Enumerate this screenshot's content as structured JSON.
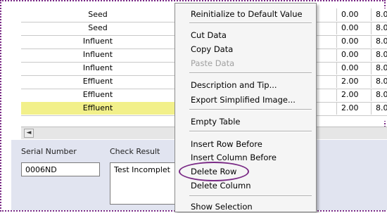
{
  "table": {
    "rows": [
      {
        "name": "Seed",
        "v1": "0.00",
        "v2": "8.0",
        "selected": false
      },
      {
        "name": "Seed",
        "v1": "0.00",
        "v2": "8.0",
        "selected": false
      },
      {
        "name": "Influent",
        "v1": "0.00",
        "v2": "8.0",
        "selected": false
      },
      {
        "name": "Influent",
        "v1": "0.00",
        "v2": "8.0",
        "selected": false
      },
      {
        "name": "Influent",
        "v1": "0.00",
        "v2": "8.0",
        "selected": false
      },
      {
        "name": "Effluent",
        "v1": "2.00",
        "v2": "8.0",
        "selected": false
      },
      {
        "name": "Effluent",
        "v1": "2.00",
        "v2": "8.0",
        "selected": false
      },
      {
        "name": "Effluent",
        "v1": "2.00",
        "v2": "8.0",
        "selected": true
      }
    ]
  },
  "scrollbar": {
    "left_arrow": "◄"
  },
  "panel": {
    "serial_label": "Serial Number",
    "serial_value": "0006ND",
    "check_label": "Check Result",
    "check_value": "Test Incomplet"
  },
  "menu": {
    "items": [
      {
        "label": "Reinitialize to Default Value",
        "disabled": false
      },
      {
        "label": "Cut Data",
        "disabled": false
      },
      {
        "label": "Copy Data",
        "disabled": false
      },
      {
        "label": "Paste Data",
        "disabled": true
      },
      {
        "label": "Description and Tip...",
        "disabled": false
      },
      {
        "label": "Export Simplified Image...",
        "disabled": false
      },
      {
        "label": "Empty Table",
        "disabled": false
      },
      {
        "label": "Insert Row Before",
        "disabled": false
      },
      {
        "label": "Insert Column Before",
        "disabled": false
      },
      {
        "label": "Delete Row",
        "disabled": false
      },
      {
        "label": "Delete Column",
        "disabled": false
      },
      {
        "label": "Show Selection",
        "disabled": false
      }
    ]
  },
  "colors": {
    "highlight": "#f2f08a",
    "annotation": "#7a2b86",
    "panel": "#e1e4f0"
  }
}
